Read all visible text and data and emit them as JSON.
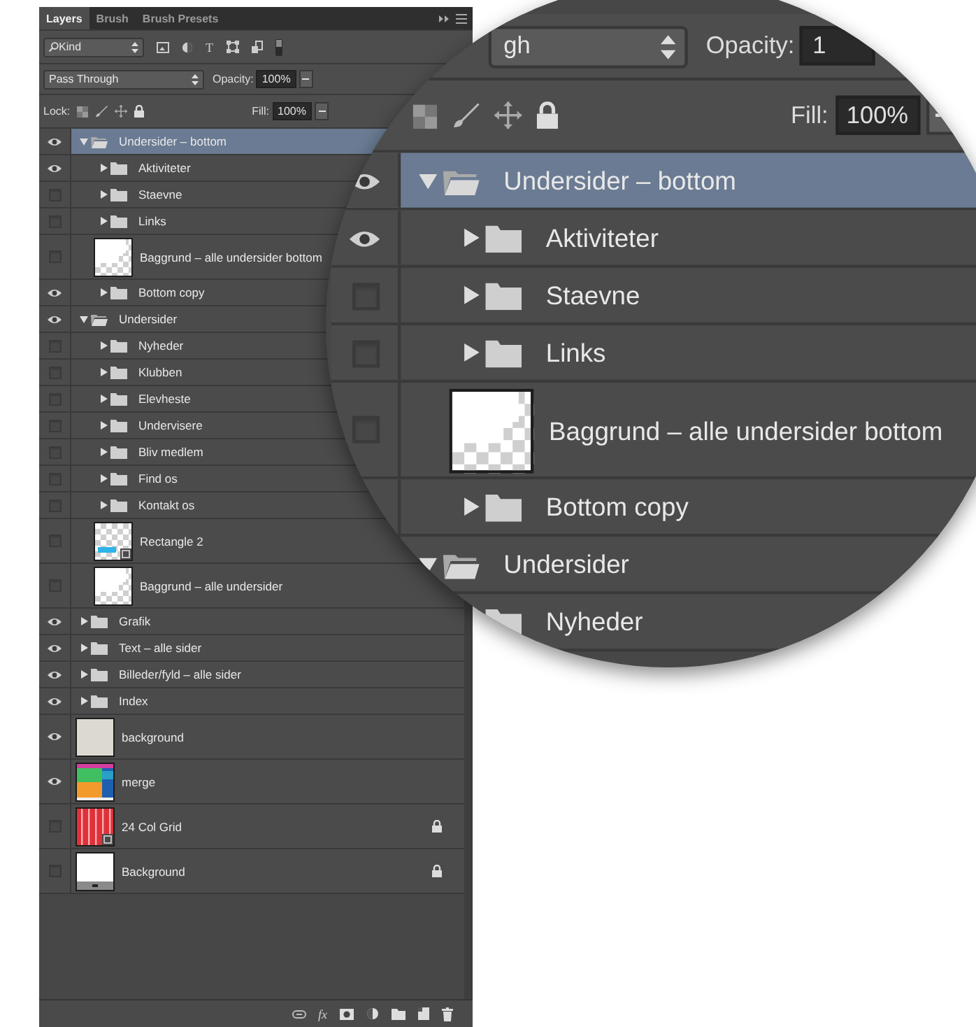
{
  "panel": {
    "tabs": [
      {
        "label": "Layers",
        "selected": true
      },
      {
        "label": "Brush",
        "selected": false
      },
      {
        "label": "Brush Presets",
        "selected": false
      }
    ],
    "filter": {
      "value": "Kind",
      "type_glyph": "T"
    },
    "blend_mode": "Pass Through",
    "opacity_label": "Opacity:",
    "opacity": "100%",
    "lock_label": "Lock:",
    "fill_label": "Fill:",
    "fill": "100%",
    "layers": [
      {
        "name": "Undersider – bottom",
        "kind": "group",
        "visible": true,
        "expanded": true,
        "selected": true,
        "children": [
          {
            "name": "Aktiviteter",
            "kind": "group",
            "visible": true,
            "expanded": false,
            "selected": false
          },
          {
            "name": "Staevne",
            "kind": "group",
            "visible": false,
            "expanded": false,
            "selected": false
          },
          {
            "name": "Links",
            "kind": "group",
            "visible": false,
            "expanded": false,
            "selected": false
          },
          {
            "name": "Baggrund – alle undersider bottom",
            "kind": "transparent",
            "visible": false,
            "selected": false,
            "locked": false
          },
          {
            "name": "Bottom copy",
            "kind": "group",
            "visible": true,
            "expanded": false,
            "selected": false
          }
        ]
      },
      {
        "name": "Undersider",
        "kind": "group",
        "visible": true,
        "expanded": true,
        "selected": false,
        "children": [
          {
            "name": "Nyheder",
            "kind": "group",
            "visible": false,
            "expanded": false,
            "selected": false
          },
          {
            "name": "Klubben",
            "kind": "group",
            "visible": false,
            "expanded": false,
            "selected": false
          },
          {
            "name": "Elevheste",
            "kind": "group",
            "visible": false,
            "expanded": false,
            "selected": false
          },
          {
            "name": "Undervisere",
            "kind": "group",
            "visible": false,
            "expanded": false,
            "selected": false
          },
          {
            "name": "Bliv medlem",
            "kind": "group",
            "visible": false,
            "expanded": false,
            "selected": false
          },
          {
            "name": "Find os",
            "kind": "group",
            "visible": false,
            "expanded": false,
            "selected": false
          },
          {
            "name": "Kontakt os",
            "kind": "group",
            "visible": false,
            "expanded": false,
            "selected": false
          },
          {
            "name": "Rectangle 2",
            "kind": "shape",
            "visible": false,
            "selected": false,
            "locked": false
          },
          {
            "name": "Baggrund – alle undersider",
            "kind": "transparent",
            "visible": false,
            "selected": false,
            "locked": false
          }
        ]
      },
      {
        "name": "Grafik",
        "kind": "group",
        "visible": true,
        "expanded": false,
        "selected": false
      },
      {
        "name": "Text – alle sider",
        "kind": "group",
        "visible": true,
        "expanded": false,
        "selected": false
      },
      {
        "name": "Billeder/fyld – alle sider",
        "kind": "group",
        "visible": true,
        "expanded": false,
        "selected": false
      },
      {
        "name": "Index",
        "kind": "group",
        "visible": true,
        "expanded": false,
        "selected": false
      },
      {
        "name": "background",
        "kind": "solid",
        "visible": true,
        "selected": false,
        "locked": false
      },
      {
        "name": "merge",
        "kind": "blocks",
        "visible": true,
        "selected": false,
        "locked": false
      },
      {
        "name": "24 Col Grid",
        "kind": "grid",
        "visible": false,
        "selected": false,
        "locked": true
      },
      {
        "name": "Background",
        "kind": "background",
        "visible": false,
        "selected": false,
        "locked": true
      }
    ],
    "footer_buttons": [
      {
        "kind": "link"
      },
      {
        "kind": "effects",
        "label": "fx"
      },
      {
        "kind": "mask"
      },
      {
        "kind": "adjustment"
      },
      {
        "kind": "group"
      },
      {
        "kind": "new"
      },
      {
        "kind": "delete"
      }
    ]
  },
  "magnifier": {
    "blend_mode": "gh",
    "opacity_label": "Opacity:",
    "opacity": "1",
    "fill_label": "Fill:",
    "fill": "100%",
    "layers": [
      {
        "name": "Undersider – bottom",
        "kind": "group",
        "visible": true,
        "expanded": true,
        "selected": true,
        "children": [
          {
            "name": "Aktiviteter",
            "kind": "group",
            "visible": true,
            "expanded": false,
            "selected": false
          },
          {
            "name": "Staevne",
            "kind": "group",
            "visible": false,
            "expanded": false,
            "selected": false
          },
          {
            "name": "Links",
            "kind": "group",
            "visible": false,
            "expanded": false,
            "selected": false
          },
          {
            "name": "Baggrund – alle undersider bottom",
            "kind": "transparent",
            "visible": false,
            "selected": false
          },
          {
            "name": "Bottom copy",
            "kind": "group",
            "expanded": false,
            "selected": false
          }
        ]
      },
      {
        "name": "Undersider",
        "kind": "group",
        "expanded": true,
        "selected": false,
        "children": [
          {
            "name": "Nyheder",
            "kind": "group",
            "selected": false
          }
        ]
      }
    ]
  }
}
